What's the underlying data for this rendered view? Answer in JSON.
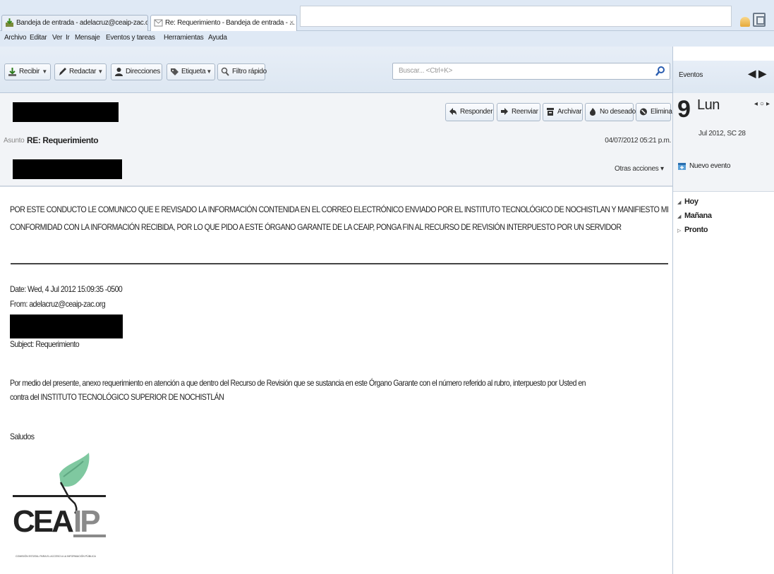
{
  "tabs": [
    {
      "label": "Bandeja de entrada - adelacruz@ceaip-zac.o..."
    },
    {
      "label": "Re: Requerimiento - Bandeja de entrada - ...",
      "close": "×"
    }
  ],
  "menu": [
    "Archivo",
    "Editar",
    "Ver",
    "Ir",
    "Mensaje",
    "Eventos y tareas",
    "Herramientas",
    "Ayuda"
  ],
  "toolbar": {
    "receive": "Recibir",
    "compose": "Redactar",
    "addresses": "Direcciones",
    "tag": "Etiqueta",
    "quick_filter": "Filtro rápido",
    "search_placeholder": "Buscar... <Ctrl+K>"
  },
  "header": {
    "actions": [
      "Responder",
      "Reenviar",
      "Archivar",
      "No deseado",
      "Eliminar"
    ],
    "subject_label": "Asunto",
    "subject": "RE: Requerimiento",
    "date": "04/07/2012 05:21 p.m.",
    "other_actions": "Otras acciones"
  },
  "body": {
    "reply_line1": "POR ESTE CONDUCTO LE COMUNICO QUE E REVISADO LA INFORMACIÓN CONTENIDA EN EL CORREO ELECTRÓNICO ENVIADO POR EL INSTITUTO TECNOLÓGICO DE NOCHISTLAN Y MANIFIESTO MI",
    "reply_line2": "CONFORMIDAD CON LA INFORMACIÓN RECIBIDA, POR LO QUE PIDO A ESTE ÓRGANO GARANTE DE LA CEAIP, PONGA FIN AL RECURSO DE REVISIÓN INTERPUESTO POR UN SERVIDOR",
    "quoted_date": "Date: Wed, 4 Jul 2012 15:09:35 -0500",
    "quoted_from": "From: adelacruz@ceaip-zac.org",
    "quoted_subject": "Subject: Requerimiento",
    "quoted_line1": "Por medio del presente, anexo requerimiento en atención a que dentro del Recurso de Revisión que se sustancia en este Órgano Garante con el número referido al rubro, interpuesto por Usted en",
    "quoted_line2": "contra del INSTITUTO TECNOLÓGICO SUPERIOR DE NOCHISTLÁN",
    "closing": "Saludos",
    "logo_text": "CEAIP",
    "logo_caption": "COMISIÓN ESTATAL PARA EL ACCESO A LA INFORMACIÓN PÚBLICA"
  },
  "events_panel": {
    "title": "Eventos",
    "day_number": "9",
    "day_name": "Lun",
    "day_sub": "Jul 2012, SC 28",
    "new_event": "Nuevo evento",
    "groups": [
      "Hoy",
      "Mañana",
      "Pronto"
    ]
  }
}
